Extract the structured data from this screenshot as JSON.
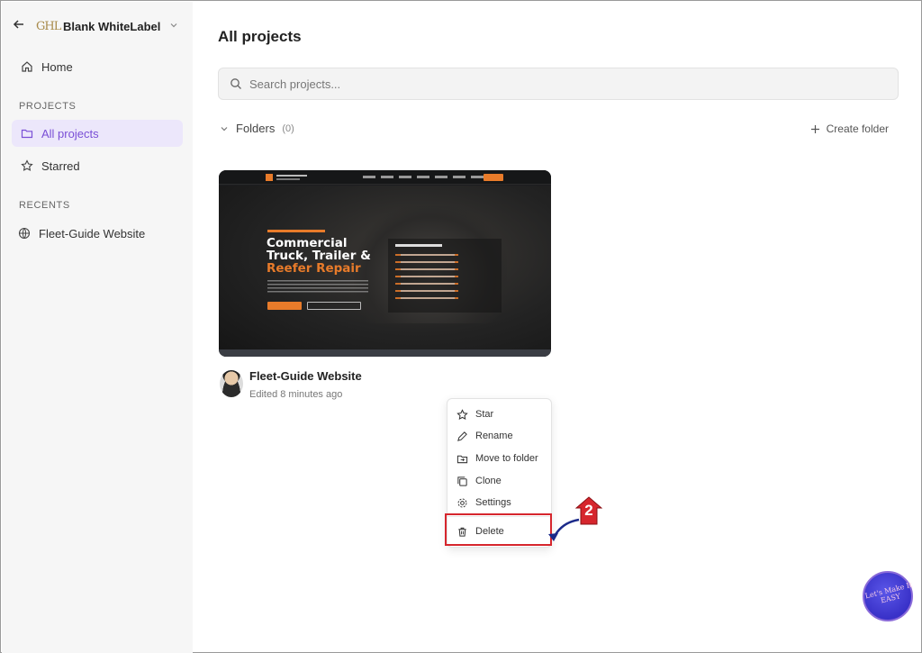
{
  "workspace": {
    "name": "Blank WhiteLabel",
    "logo_text": "GHL"
  },
  "sidebar": {
    "home_label": "Home",
    "projects_section": "PROJECTS",
    "all_projects_label": "All projects",
    "starred_label": "Starred",
    "recents_section": "RECENTS",
    "recent_item_label": "Fleet-Guide Website"
  },
  "main": {
    "title": "All projects",
    "search_placeholder": "Search projects...",
    "folders_label": "Folders",
    "folders_count": "(0)",
    "create_folder_label": "Create folder"
  },
  "project": {
    "name": "Fleet-Guide Website",
    "meta": "Edited 8 minutes ago",
    "thumbnail": {
      "headline_line1": "Commercial",
      "headline_line2": "Truck, Trailer &",
      "headline_line3": "Reefer Repair"
    }
  },
  "context_menu": {
    "items": [
      {
        "label": "Star",
        "icon": "star-icon"
      },
      {
        "label": "Rename",
        "icon": "pencil-icon"
      },
      {
        "label": "Move to folder",
        "icon": "folder-move-icon"
      },
      {
        "label": "Clone",
        "icon": "copy-icon"
      },
      {
        "label": "Settings",
        "icon": "gear-icon"
      },
      {
        "label": "Delete",
        "icon": "trash-icon"
      }
    ]
  },
  "annotation": {
    "step_number": "2"
  },
  "watermark": {
    "text": "Let's Make It EASY"
  },
  "colors": {
    "accent": "#7a4fd6",
    "active_bg": "#ece7fb",
    "highlight": "#d6262d",
    "brand_orange": "#e87b2a"
  }
}
